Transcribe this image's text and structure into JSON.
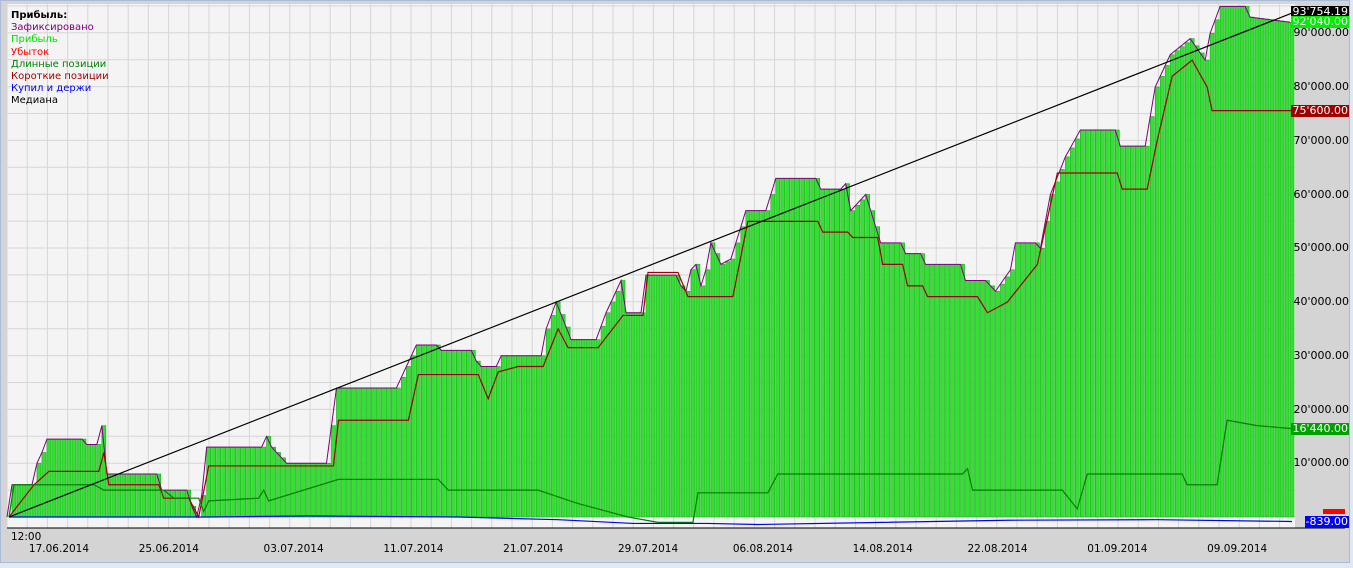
{
  "chart_data": {
    "type": "line",
    "title": "Прибыль:",
    "legend": [
      {
        "label": "Зафиксировано",
        "color": "#800080"
      },
      {
        "label": "Прибыль",
        "color": "#00e000"
      },
      {
        "label": "Убыток",
        "color": "#ff0000"
      },
      {
        "label": "Длинные позиции",
        "color": "#008000"
      },
      {
        "label": "Короткие позиции",
        "color": "#a00000"
      },
      {
        "label": "Купил и держи",
        "color": "#0000ff"
      },
      {
        "label": "Медиана",
        "color": "#000000"
      }
    ],
    "legend_position": "top-left",
    "ylim": [
      -2000,
      96500
    ],
    "xlim": [
      0,
      257
    ],
    "yticks": [
      "10'000.00",
      "20'000.00",
      "30'000.00",
      "40'000.00",
      "50'000.00",
      "60'000.00",
      "70'000.00",
      "80'000.00",
      "90'000.00"
    ],
    "ytick_values": [
      10000,
      20000,
      30000,
      40000,
      50000,
      60000,
      70000,
      80000,
      90000
    ],
    "time_label": "12:00",
    "xticks": [
      {
        "bar": 10,
        "label": "17.06.2014"
      },
      {
        "bar": 32,
        "label": "25.06.2014"
      },
      {
        "bar": 57,
        "label": "03.07.2014"
      },
      {
        "bar": 81,
        "label": "11.07.2014"
      },
      {
        "bar": 105,
        "label": "21.07.2014"
      },
      {
        "bar": 128,
        "label": "29.07.2014"
      },
      {
        "bar": 151,
        "label": "06.08.2014"
      },
      {
        "bar": 175,
        "label": "14.08.2014"
      },
      {
        "bar": 198,
        "label": "22.08.2014"
      },
      {
        "bar": 222,
        "label": "01.09.2014"
      },
      {
        "bar": 246,
        "label": "09.09.2014"
      }
    ],
    "series": [
      {
        "name": "Прибыль",
        "kind": "bars",
        "color": "#22dd22",
        "points": [
          [
            0,
            0
          ],
          [
            1,
            6000
          ],
          [
            5,
            6000
          ],
          [
            6,
            10000
          ],
          [
            7,
            12000
          ],
          [
            8,
            14500
          ],
          [
            15,
            14500
          ],
          [
            16,
            13500
          ],
          [
            18,
            13500
          ],
          [
            19,
            17000
          ],
          [
            20,
            8000
          ],
          [
            30,
            8000
          ],
          [
            31,
            5000
          ],
          [
            36,
            5000
          ],
          [
            37,
            2000
          ],
          [
            38,
            0
          ],
          [
            39,
            4000
          ],
          [
            40,
            13000
          ],
          [
            51,
            13000
          ],
          [
            52,
            15000
          ],
          [
            53,
            13000
          ],
          [
            56,
            10000
          ],
          [
            64,
            10000
          ],
          [
            65,
            17000
          ],
          [
            66,
            24000
          ],
          [
            78,
            24000
          ],
          [
            80,
            28000
          ],
          [
            82,
            32000
          ],
          [
            86,
            32000
          ],
          [
            87,
            31000
          ],
          [
            93,
            31000
          ],
          [
            94,
            29000
          ],
          [
            95,
            28000
          ],
          [
            98,
            28000
          ],
          [
            99,
            30000
          ],
          [
            107,
            30000
          ],
          [
            108,
            35000
          ],
          [
            110,
            40000
          ],
          [
            113,
            33000
          ],
          [
            118,
            33000
          ],
          [
            120,
            38000
          ],
          [
            123,
            44000
          ],
          [
            124,
            38000
          ],
          [
            127,
            38000
          ],
          [
            128,
            45000
          ],
          [
            134,
            45000
          ],
          [
            135,
            43000
          ],
          [
            136,
            42000
          ],
          [
            137,
            46000
          ],
          [
            138,
            47000
          ],
          [
            139,
            43000
          ],
          [
            140,
            46000
          ],
          [
            141,
            51000
          ],
          [
            143,
            47000
          ],
          [
            145,
            48000
          ],
          [
            146,
            51000
          ],
          [
            148,
            57000
          ],
          [
            152,
            57000
          ],
          [
            154,
            63000
          ],
          [
            162,
            63000
          ],
          [
            163,
            61000
          ],
          [
            167,
            61000
          ],
          [
            168,
            62000
          ],
          [
            169,
            57000
          ],
          [
            172,
            60000
          ],
          [
            174,
            54000
          ],
          [
            175,
            51000
          ],
          [
            179,
            51000
          ],
          [
            180,
            49000
          ],
          [
            183,
            49000
          ],
          [
            184,
            47000
          ],
          [
            191,
            47000
          ],
          [
            192,
            44000
          ],
          [
            196,
            44000
          ],
          [
            198,
            42000
          ],
          [
            201,
            46000
          ],
          [
            202,
            51000
          ],
          [
            206,
            51000
          ],
          [
            207,
            50000
          ],
          [
            209,
            60000
          ],
          [
            212,
            67000
          ],
          [
            215,
            72000
          ],
          [
            222,
            72000
          ],
          [
            223,
            69000
          ],
          [
            228,
            69000
          ],
          [
            230,
            80000
          ],
          [
            233,
            86000
          ],
          [
            237,
            89000
          ],
          [
            240,
            85000
          ],
          [
            241,
            90000
          ],
          [
            243,
            95000
          ],
          [
            248,
            95000
          ],
          [
            249,
            93000
          ],
          [
            257,
            92040
          ]
        ]
      },
      {
        "name": "Короткие позиции",
        "kind": "line",
        "color": "#a00000",
        "points": [
          [
            0,
            0
          ],
          [
            5,
            6000
          ],
          [
            8,
            8500
          ],
          [
            18,
            8500
          ],
          [
            19,
            12000
          ],
          [
            20,
            6000
          ],
          [
            30,
            6000
          ],
          [
            31,
            3500
          ],
          [
            36,
            3500
          ],
          [
            38,
            0
          ],
          [
            40,
            9500
          ],
          [
            65,
            9500
          ],
          [
            66,
            18000
          ],
          [
            80,
            18000
          ],
          [
            82,
            26500
          ],
          [
            94,
            26500
          ],
          [
            96,
            22000
          ],
          [
            98,
            27000
          ],
          [
            102,
            28000
          ],
          [
            107,
            28000
          ],
          [
            110,
            35000
          ],
          [
            112,
            31500
          ],
          [
            118,
            31500
          ],
          [
            123,
            37500
          ],
          [
            127,
            37500
          ],
          [
            128,
            45500
          ],
          [
            134,
            45500
          ],
          [
            136,
            41000
          ],
          [
            145,
            41000
          ],
          [
            148,
            55000
          ],
          [
            162,
            55000
          ],
          [
            163,
            53000
          ],
          [
            168,
            53000
          ],
          [
            169,
            52000
          ],
          [
            174,
            52000
          ],
          [
            175,
            47000
          ],
          [
            179,
            47000
          ],
          [
            180,
            43000
          ],
          [
            183,
            43000
          ],
          [
            184,
            41000
          ],
          [
            194,
            41000
          ],
          [
            196,
            38000
          ],
          [
            200,
            40000
          ],
          [
            206,
            47000
          ],
          [
            210,
            64000
          ],
          [
            222,
            64000
          ],
          [
            223,
            61000
          ],
          [
            228,
            61000
          ],
          [
            230,
            70000
          ],
          [
            233,
            82000
          ],
          [
            237,
            85000
          ],
          [
            240,
            80000
          ],
          [
            241,
            75600
          ],
          [
            257,
            75600
          ]
        ]
      },
      {
        "name": "Длинные позиции",
        "kind": "line",
        "color": "#008000",
        "points": [
          [
            0,
            0
          ],
          [
            1,
            6000
          ],
          [
            17,
            6000
          ],
          [
            19,
            5000
          ],
          [
            31,
            5000
          ],
          [
            33,
            3500
          ],
          [
            38,
            3500
          ],
          [
            39,
            1000
          ],
          [
            40,
            3000
          ],
          [
            50,
            3500
          ],
          [
            51,
            5000
          ],
          [
            52,
            3000
          ],
          [
            66,
            7000
          ],
          [
            86,
            7000
          ],
          [
            88,
            5000
          ],
          [
            106,
            5000
          ],
          [
            114,
            2500
          ],
          [
            124,
            0
          ],
          [
            130,
            -1000
          ],
          [
            137,
            -1000
          ],
          [
            138,
            4500
          ],
          [
            152,
            4500
          ],
          [
            154,
            8000
          ],
          [
            191,
            8000
          ],
          [
            192,
            9000
          ],
          [
            193,
            5000
          ],
          [
            211,
            5000
          ],
          [
            214,
            1500
          ],
          [
            216,
            8000
          ],
          [
            235,
            8000
          ],
          [
            236,
            6000
          ],
          [
            242,
            6000
          ],
          [
            244,
            18000
          ],
          [
            250,
            17000
          ],
          [
            257,
            16440
          ]
        ]
      },
      {
        "name": "Купил и держи",
        "kind": "line",
        "color": "#0000ff",
        "points": [
          [
            0,
            0
          ],
          [
            40,
            0
          ],
          [
            60,
            200
          ],
          [
            90,
            0
          ],
          [
            110,
            -500
          ],
          [
            125,
            -1200
          ],
          [
            140,
            -1200
          ],
          [
            150,
            -1400
          ],
          [
            175,
            -1000
          ],
          [
            200,
            -600
          ],
          [
            230,
            -500
          ],
          [
            257,
            -839
          ]
        ]
      },
      {
        "name": "Медиана",
        "kind": "line",
        "color": "#000000",
        "points": [
          [
            0,
            0
          ],
          [
            257,
            93754.19
          ]
        ]
      }
    ],
    "value_labels": [
      {
        "text": "93'754.19",
        "value": 93754.19,
        "bg": "#000000"
      },
      {
        "text": "92'040.00",
        "value": 92040,
        "bg": "#00ee00"
      },
      {
        "text": "75'600.00",
        "value": 75600,
        "bg": "#a00000"
      },
      {
        "text": "16'440.00",
        "value": 16440,
        "bg": "#00a000"
      },
      {
        "text": "-839.00",
        "value": -839,
        "bg": "#0000ff"
      }
    ]
  }
}
